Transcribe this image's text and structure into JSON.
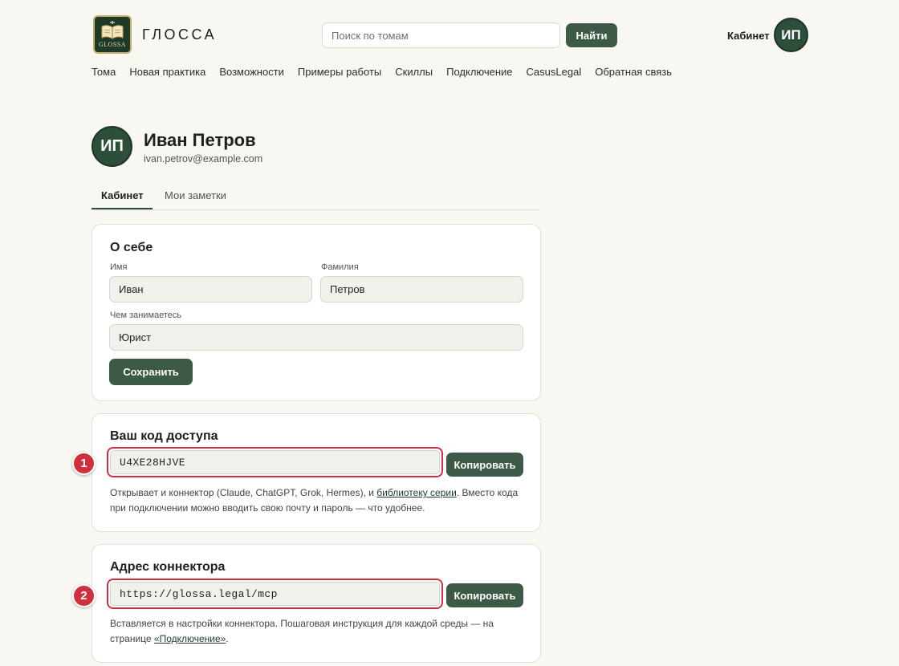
{
  "header": {
    "brand": "ГЛОССА",
    "logo_text": "GLOSSA",
    "search_placeholder": "Поиск по томам",
    "search_button": "Найти",
    "cabinet_label": "Кабинет",
    "avatar_initials": "ИП"
  },
  "nav": [
    {
      "label": "Тома"
    },
    {
      "label": "Новая практика"
    },
    {
      "label": "Возможности"
    },
    {
      "label": "Примеры работы"
    },
    {
      "label": "Скиллы"
    },
    {
      "label": "Подключение"
    },
    {
      "label": "CasusLegal"
    },
    {
      "label": "Обратная связь"
    }
  ],
  "profile": {
    "initials": "ИП",
    "name": "Иван Петров",
    "email": "ivan.petrov@example.com"
  },
  "tabs": [
    {
      "label": "Кабинет",
      "active": true
    },
    {
      "label": "Мои заметки",
      "active": false
    }
  ],
  "about": {
    "title": "О себе",
    "first_name_label": "Имя",
    "first_name_value": "Иван",
    "last_name_label": "Фамилия",
    "last_name_value": "Петров",
    "occupation_label": "Чем занимаетесь",
    "occupation_value": "Юрист",
    "save_button": "Сохранить"
  },
  "access_code": {
    "title": "Ваш код доступа",
    "marker": "1",
    "code": "U4XE28HJVE",
    "copy_button": "Копировать",
    "note_before": "Открывает и коннектор (Claude, ChatGPT, Grok, Hermes), и ",
    "note_link": "библиотеку серии",
    "note_after": ". Вместо кода при подключении можно вводить свою почту и пароль — что удобнее."
  },
  "connector": {
    "title": "Адрес коннектора",
    "marker": "2",
    "url": "https://glossa.legal/mcp",
    "copy_button": "Копировать",
    "note_before": "Вставляется в настройки коннектора. Пошаговая инструкция для каждой среды — на странице ",
    "note_link": "«Подключение»",
    "note_after": "."
  },
  "colors": {
    "accent": "#3c5a46",
    "avatar": "#2d4f3a",
    "highlight": "#d0303e",
    "background": "#f8f7f2"
  }
}
